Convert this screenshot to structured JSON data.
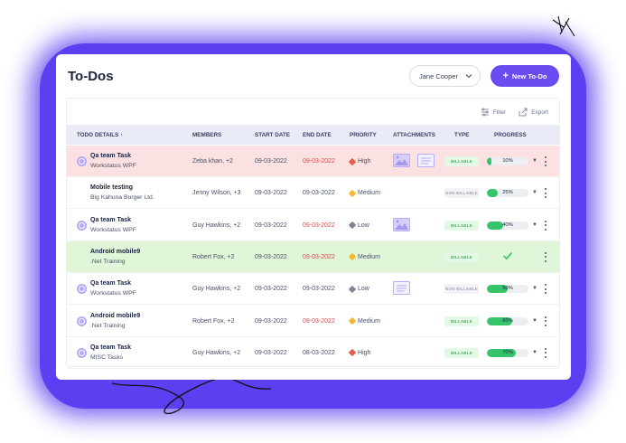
{
  "header": {
    "title": "To-Dos",
    "user_select": "Jane Cooper",
    "new_button": "New To-Do"
  },
  "toolbar": {
    "filter": "Filter",
    "export": "Export"
  },
  "columns": {
    "details": "TODO DETAILS ↑",
    "members": "MEMBERS",
    "start": "START DATE",
    "end": "END DATE",
    "priority": "PRIORITY",
    "attachments": "ATTACHMENTS",
    "type": "TYPE",
    "progress": "PROGRESS"
  },
  "rows": [
    {
      "name": "Qa team Task",
      "sub": "Workstatus WPF",
      "members": "Zeba khan, +2",
      "start": "09-03-2022",
      "end": "09-03-2022",
      "priority": "High",
      "type": "BILLABLE",
      "progress": "10%",
      "progress_value": 10,
      "bg": "red",
      "end_overdue": true,
      "has_icon": true,
      "attachments": [
        "image",
        "doc"
      ],
      "done": false
    },
    {
      "name": "Mobile testing",
      "sub": "Big Kahuna Burger Ltd.",
      "members": "Jenny Wilson, +3",
      "start": "09-03-2022",
      "end": "09-03-2022",
      "priority": "Medium",
      "type": "NON BILLABLE",
      "progress": "25%",
      "progress_value": 25,
      "bg": "white",
      "end_overdue": false,
      "has_icon": false,
      "attachments": [],
      "done": false
    },
    {
      "name": "Qa team Task",
      "sub": "Workstatus WPF",
      "members": "Guy Hawkins, +2",
      "start": "09-03-2022",
      "end": "09-03-2022",
      "priority": "Low",
      "type": "BILLABLE",
      "progress": "40%",
      "progress_value": 40,
      "bg": "white",
      "end_overdue": true,
      "has_icon": true,
      "attachments": [
        "image"
      ],
      "done": false
    },
    {
      "name": "Android mobile9",
      "sub": ".Net Training",
      "members": "Robert Fox, +2",
      "start": "09-03-2022",
      "end": "09-03-2022",
      "priority": "Medium",
      "type": "BILLABLE",
      "progress": "",
      "progress_value": 100,
      "bg": "green",
      "end_overdue": true,
      "has_icon": false,
      "attachments": [],
      "done": true
    },
    {
      "name": "Qa team Task",
      "sub": "Workstatus WPF",
      "members": "Guy Hawkins, +2",
      "start": "09-03-2022",
      "end": "09-03-2022",
      "priority": "Low",
      "type": "NON BILLABLE",
      "progress": "50%",
      "progress_value": 50,
      "bg": "white",
      "end_overdue": false,
      "has_icon": true,
      "attachments": [
        "doc"
      ],
      "done": false
    },
    {
      "name": "Android mobile9",
      "sub": ".Net Training",
      "members": "Robert Fox, +2",
      "start": "09-03-2022",
      "end": "09-03-2022",
      "priority": "Medium",
      "type": "BILLABLE",
      "progress": "60%",
      "progress_value": 60,
      "bg": "white",
      "end_overdue": true,
      "has_icon": true,
      "attachments": [],
      "done": false
    },
    {
      "name": "Qa team Task",
      "sub": "MISC Tasks",
      "members": "Guy Hawkins, +2",
      "start": "09-03-2022",
      "end": "08-03-2022",
      "priority": "High",
      "type": "BILLABLE",
      "progress": "70%",
      "progress_value": 70,
      "bg": "white",
      "end_overdue": false,
      "has_icon": true,
      "attachments": [],
      "done": false
    }
  ],
  "colors": {
    "accent": "#6a4cf0",
    "high": "#e85d4a",
    "medium": "#f5b82e",
    "low": "#7d8294",
    "progress": "#35c46a",
    "overdue": "#e0474c"
  }
}
